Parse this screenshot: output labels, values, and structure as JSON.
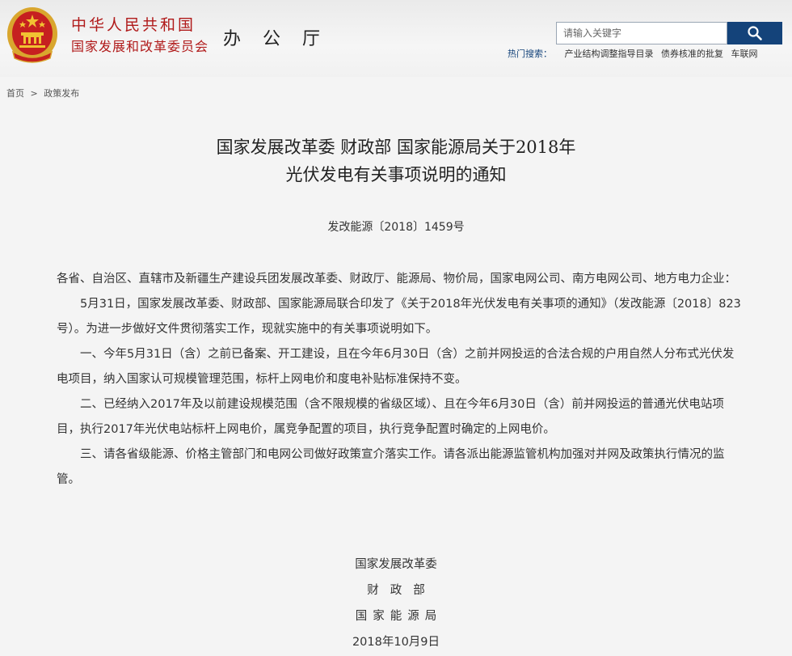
{
  "header": {
    "org_line1": "中华人民共和国",
    "org_line2": "国家发展和改革委员会",
    "office": "办 公 厅",
    "search": {
      "placeholder": "请输入关键字"
    },
    "hot_label": "热门搜索：",
    "hot_items": [
      "产业结构调整指导目录",
      "债券核准的批复",
      "车联网"
    ]
  },
  "breadcrumb": {
    "home": "首页",
    "separator": ">",
    "current": "政策发布"
  },
  "article": {
    "title_line1": "国家发展改革委 财政部 国家能源局关于2018年",
    "title_line2": "光伏发电有关事项说明的通知",
    "doc_number": "发改能源〔2018〕1459号",
    "addressee": "各省、自治区、直辖市及新疆生产建设兵团发展改革委、财政厅、能源局、物价局，国家电网公司、南方电网公司、地方电力企业：",
    "paragraphs": [
      "5月31日，国家发展改革委、财政部、国家能源局联合印发了《关于2018年光伏发电有关事项的通知》（发改能源〔2018〕823号）。为进一步做好文件贯彻落实工作，现就实施中的有关事项说明如下。",
      "一、今年5月31日（含）之前已备案、开工建设，且在今年6月30日（含）之前并网投运的合法合规的户用自然人分布式光伏发电项目，纳入国家认可规模管理范围，标杆上网电价和度电补贴标准保持不变。",
      "二、已经纳入2017年及以前建设规模范围（含不限规模的省级区域）、且在今年6月30日（含）前并网投运的普通光伏电站项目，执行2017年光伏电站标杆上网电价，属竞争配置的项目，执行竞争配置时确定的上网电价。",
      "三、请各省级能源、价格主管部门和电网公司做好政策宣介落实工作。请各派出能源监管机构加强对并网及政策执行情况的监管。"
    ],
    "signatures": [
      "国家发展改革委",
      "财政部",
      "国家能源局"
    ],
    "date": "2018年10月9日"
  },
  "colors": {
    "brand_red": "#b01a1a",
    "brand_blue": "#14437a",
    "background": "#f4f4f4"
  },
  "icons": {
    "emblem": "national-emblem-icon",
    "search": "search-icon"
  }
}
